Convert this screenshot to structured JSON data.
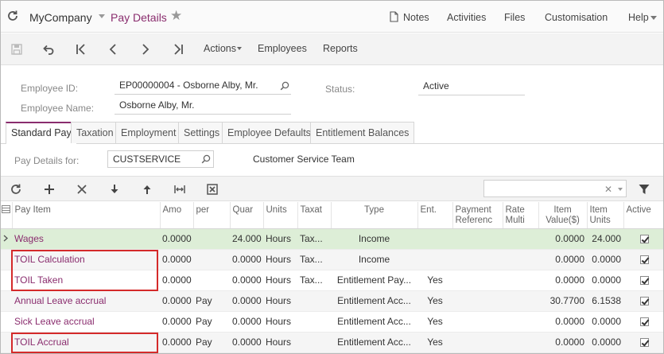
{
  "topbar": {
    "company": "MyCompany",
    "screen_title": "Pay Details",
    "links": {
      "notes": "Notes",
      "activities": "Activities",
      "files": "Files",
      "customisation": "Customisation",
      "help": "Help"
    }
  },
  "toolbar": {
    "actions": "Actions",
    "employees": "Employees",
    "reports": "Reports"
  },
  "form": {
    "employee_id_label": "Employee ID:",
    "employee_id_value": "EP00000004 - Osborne Alby, Mr.",
    "employee_name_label": "Employee Name:",
    "employee_name_value": "Osborne Alby, Mr.",
    "status_label": "Status:",
    "status_value": "Active"
  },
  "tabs": [
    "Standard Pay",
    "Taxation",
    "Employment",
    "Settings",
    "Employee Defaults",
    "Entitlement Balances"
  ],
  "pay_details": {
    "label": "Pay Details for:",
    "value": "CUSTSERVICE",
    "description": "Customer Service Team"
  },
  "grid": {
    "columns": [
      "Pay Item",
      "Amo",
      "per",
      "Quar",
      "Units",
      "Taxat",
      "Type",
      "Ent.",
      "Payment Referenc",
      "Rate Multi",
      "Item Value($)",
      "Item Units",
      "Active"
    ],
    "rows": [
      {
        "pay_item": "Wages",
        "amount": "0.0000",
        "per": "",
        "quantity": "24.000",
        "units": "Hours",
        "tax": "Tax...",
        "type": "Income",
        "ent": "",
        "payment_ref": "",
        "rate_multi": "",
        "item_value": "0.0000",
        "item_units": "24.000",
        "active": true
      },
      {
        "pay_item": "TOIL Calculation",
        "amount": "0.0000",
        "per": "",
        "quantity": "0.0000",
        "units": "Hours",
        "tax": "Tax...",
        "type": "Income",
        "ent": "",
        "payment_ref": "",
        "rate_multi": "",
        "item_value": "0.0000",
        "item_units": "0.0000",
        "active": true
      },
      {
        "pay_item": "TOIL Taken",
        "amount": "0.0000",
        "per": "",
        "quantity": "0.0000",
        "units": "Hours",
        "tax": "Tax...",
        "type": "Entitlement Pay...",
        "ent": "Yes",
        "payment_ref": "",
        "rate_multi": "",
        "item_value": "0.0000",
        "item_units": "0.0000",
        "active": true
      },
      {
        "pay_item": "Annual Leave accrual",
        "amount": "0.0000",
        "per": "Pay",
        "quantity": "0.0000",
        "units": "Hours",
        "tax": "",
        "type": "Entitlement Acc...",
        "ent": "Yes",
        "payment_ref": "",
        "rate_multi": "",
        "item_value": "30.7700",
        "item_units": "6.1538",
        "active": true
      },
      {
        "pay_item": "Sick Leave accrual",
        "amount": "0.0000",
        "per": "Pay",
        "quantity": "0.0000",
        "units": "Hours",
        "tax": "",
        "type": "Entitlement Acc...",
        "ent": "Yes",
        "payment_ref": "",
        "rate_multi": "",
        "item_value": "0.0000",
        "item_units": "0.0000",
        "active": true
      },
      {
        "pay_item": "TOIL Accrual",
        "amount": "0.0000",
        "per": "Pay",
        "quantity": "0.0000",
        "units": "Hours",
        "tax": "",
        "type": "Entitlement Acc...",
        "ent": "Yes",
        "payment_ref": "",
        "rate_multi": "",
        "item_value": "0.0000",
        "item_units": "0.0000",
        "active": true
      }
    ]
  },
  "colors": {
    "accent": "#8a2d6e",
    "selected_row": "#ddeed7",
    "highlight_box": "#d42a2a"
  }
}
